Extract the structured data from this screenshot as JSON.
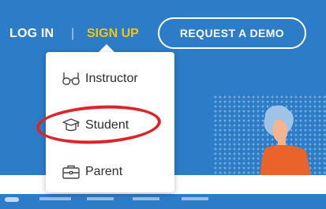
{
  "nav": {
    "login": "LOG IN",
    "separator": "|",
    "signup": "SIGN UP",
    "request_demo": "REQUEST A DEMO"
  },
  "dropdown": {
    "items": [
      {
        "label": "Instructor",
        "icon": "glasses-icon"
      },
      {
        "label": "Student",
        "icon": "graduation-cap-icon"
      },
      {
        "label": "Parent",
        "icon": "briefcase-icon"
      }
    ]
  },
  "colors": {
    "background": "#2c7cc7",
    "signup_accent": "#f2c21b",
    "highlight_ring": "#d9262b"
  }
}
